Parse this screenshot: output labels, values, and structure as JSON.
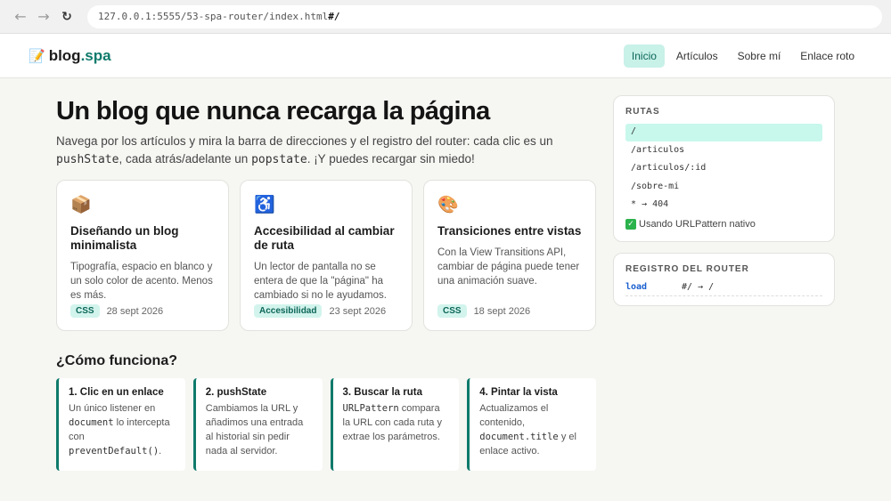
{
  "browser": {
    "back_icon": "arrow-left-icon",
    "forward_icon": "arrow-right-icon",
    "reload_icon": "reload-icon",
    "url_base": "127.0.0.1:5555/53-spa-router/index.html",
    "url_hash": "#/"
  },
  "header": {
    "logo_icon": "memo-icon",
    "logo_main": "blog",
    "logo_accent": ".spa",
    "nav": [
      {
        "label": "Inicio",
        "active": true
      },
      {
        "label": "Artículos",
        "active": false
      },
      {
        "label": "Sobre mí",
        "active": false
      },
      {
        "label": "Enlace roto",
        "active": false
      }
    ]
  },
  "main": {
    "title": "Un blog que nunca recarga la página",
    "intro": {
      "part1": "Navega por los artículos y mira la barra de direcciones y el registro del router: cada clic es un ",
      "code1": "pushState",
      "part2": ", cada atrás/adelante un ",
      "code2": "popstate",
      "part3": ". ¡Y puedes recargar sin miedo!"
    },
    "cards": [
      {
        "icon": "📦",
        "icon_name": "box-icon",
        "title": "Diseñando un blog minimalista",
        "desc": "Tipografía, espacio en blanco y un solo color de acento. Menos es más.",
        "tag": "CSS",
        "date": "28 sept 2026"
      },
      {
        "icon": "♿",
        "icon_name": "accessibility-icon",
        "title": "Accesibilidad al cambiar de ruta",
        "desc": "Un lector de pantalla no se entera de que la \"página\" ha cambiado si no le ayudamos.",
        "tag": "Accesibilidad",
        "date": "23 sept 2026"
      },
      {
        "icon": "🎨",
        "icon_name": "palette-icon",
        "title": "Transiciones entre vistas",
        "desc": "Con la View Transitions API, cambiar de página puede tener una animación suave.",
        "tag": "CSS",
        "date": "18 sept 2026"
      }
    ],
    "how_title": "¿Cómo funciona?",
    "steps": [
      {
        "title": "1. Clic en un enlace",
        "t1": "Un único listener en ",
        "c1": "document",
        "t2": " lo intercepta con ",
        "c2": "preventDefault()",
        "t3": "."
      },
      {
        "title": "2. pushState",
        "t1": "Cambiamos la URL y añadimos una entrada al historial sin pedir nada al servidor.",
        "c1": "",
        "t2": "",
        "c2": "",
        "t3": ""
      },
      {
        "title": "3. Buscar la ruta",
        "t1": "",
        "c1": "URLPattern",
        "t2": " compara la URL con cada ruta y extrae los parámetros.",
        "c2": "",
        "t3": ""
      },
      {
        "title": "4. Pintar la vista",
        "t1": "Actualizamos el contenido, ",
        "c1": "document.title",
        "t2": " y el enlace activo.",
        "c2": "",
        "t3": ""
      }
    ]
  },
  "sidebar": {
    "routes_title": "RUTAS",
    "routes": [
      {
        "path": "/",
        "active": true
      },
      {
        "path": "/articulos",
        "active": false
      },
      {
        "path": "/articulos/:id",
        "active": false
      },
      {
        "path": "/sobre-mi",
        "active": false
      },
      {
        "path": "* → 404",
        "active": false
      }
    ],
    "native_icon": "check-mark-icon",
    "native_text": "Usando URLPattern nativo",
    "log_title": "REGISTRO DEL ROUTER",
    "log": [
      {
        "type": "load",
        "path": "#/ → /"
      }
    ]
  }
}
